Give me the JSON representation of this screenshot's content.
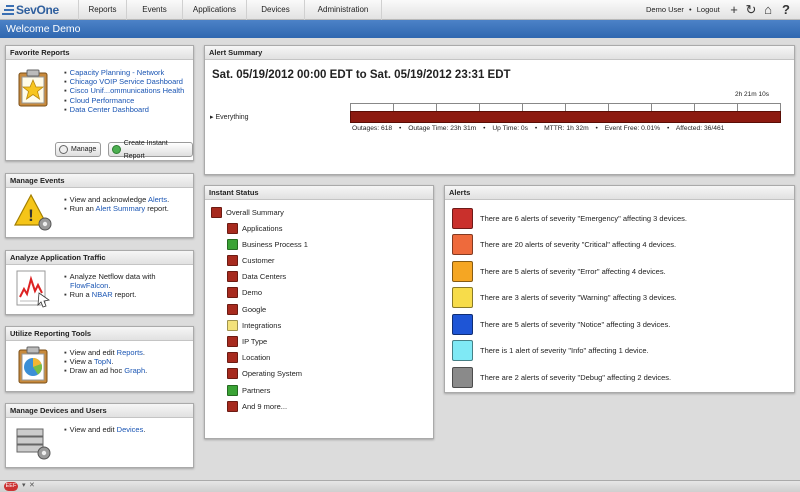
{
  "logo": {
    "text": "SevOne"
  },
  "nav": {
    "items": [
      "Reports",
      "Events",
      "Applications",
      "Devices",
      "Administration"
    ],
    "user": "Demo User",
    "logout": "Logout",
    "separator": "•"
  },
  "welcome": {
    "title": "Welcome Demo"
  },
  "favorite_reports": {
    "title": "Favorite Reports",
    "links": [
      "Capacity Planning - Network",
      "Chicago VOIP Service Dashboard",
      "Cisco Unif...ommunications Health",
      "Cloud Performance",
      "Data Center Dashboard"
    ],
    "manage_label": "Manage",
    "create_label": "Create Instant Report"
  },
  "manage_events": {
    "title": "Manage Events",
    "line1_pre": "View and acknowledge ",
    "line1_link": "Alerts",
    "line1_post": ".",
    "line2_pre": "Run an ",
    "line2_link": "Alert Summary",
    "line2_post": " report."
  },
  "analyze_traffic": {
    "title": "Analyze Application Traffic",
    "line1_pre": "Analyze Netflow data with",
    "line1b_link": "FlowFalcon",
    "line1b_post": ".",
    "line2_pre": "Run a ",
    "line2_link": "NBAR",
    "line2_post": " report."
  },
  "reporting_tools": {
    "title": "Utilize Reporting Tools",
    "line1_pre": "View and edit ",
    "line1_link": "Reports",
    "line1_post": ".",
    "line2_pre": "View a ",
    "line2_link": "TopN",
    "line2_post": ".",
    "line3_pre": "Draw an ad hoc ",
    "line3_link": "Graph",
    "line3_post": "."
  },
  "devices_users": {
    "title": "Manage Devices and Users",
    "line1_pre": "View and edit ",
    "line1_link": "Devices",
    "line1_post": "."
  },
  "alert_summary": {
    "title": "Alert Summary",
    "range": "Sat. 05/19/2012 00:00 EDT to Sat. 05/19/2012 23:31 EDT",
    "duration": "2h 21m 10s",
    "row_label": "Everything",
    "bar_color": "#8c1a10",
    "stats": [
      "Outages: 618",
      "Outage Time: 23h 31m",
      "Up Time: 0s",
      "MTTR: 1h 32m",
      "Event Free: 0.01%",
      "Affected: 36/461"
    ],
    "stat_sep": "•"
  },
  "instant_status": {
    "title": "Instant Status",
    "summary": {
      "label": "Overall Summary",
      "color": "#a72a1e"
    },
    "items": [
      {
        "label": "Applications",
        "color": "#a72a1e"
      },
      {
        "label": "Business Process 1",
        "color": "#3aa335"
      },
      {
        "label": "Customer",
        "color": "#a72a1e"
      },
      {
        "label": "Data Centers",
        "color": "#a72a1e"
      },
      {
        "label": "Demo",
        "color": "#a72a1e"
      },
      {
        "label": "Google",
        "color": "#a72a1e"
      },
      {
        "label": "Integrations",
        "color": "#f4e27a"
      },
      {
        "label": "IP Type",
        "color": "#a72a1e"
      },
      {
        "label": "Location",
        "color": "#a72a1e"
      },
      {
        "label": "Operating System",
        "color": "#a72a1e"
      },
      {
        "label": "Partners",
        "color": "#3aa335"
      },
      {
        "label": "And 9 more...",
        "color": "#a72a1e"
      }
    ]
  },
  "alerts": {
    "title": "Alerts",
    "items": [
      {
        "text": "There are 6 alerts of severity \"Emergency\" affecting 3 devices.",
        "color": "#c9302c"
      },
      {
        "text": "There are 20 alerts of severity \"Critical\" affecting 4 devices.",
        "color": "#ee6a3c"
      },
      {
        "text": "There are 5 alerts of severity \"Error\" affecting 4 devices.",
        "color": "#f5a623"
      },
      {
        "text": "There are 3 alerts of severity \"Warning\" affecting 3 devices.",
        "color": "#f7dc4a"
      },
      {
        "text": "There are 5 alerts of severity \"Notice\" affecting 3 devices.",
        "color": "#1e55d6"
      },
      {
        "text": "There is 1 alert of severity \"Info\" affecting 1 device.",
        "color": "#7fe9f5"
      },
      {
        "text": "There are 2 alerts of severity \"Debug\" affecting 2 devices.",
        "color": "#8a8a8a"
      }
    ]
  }
}
